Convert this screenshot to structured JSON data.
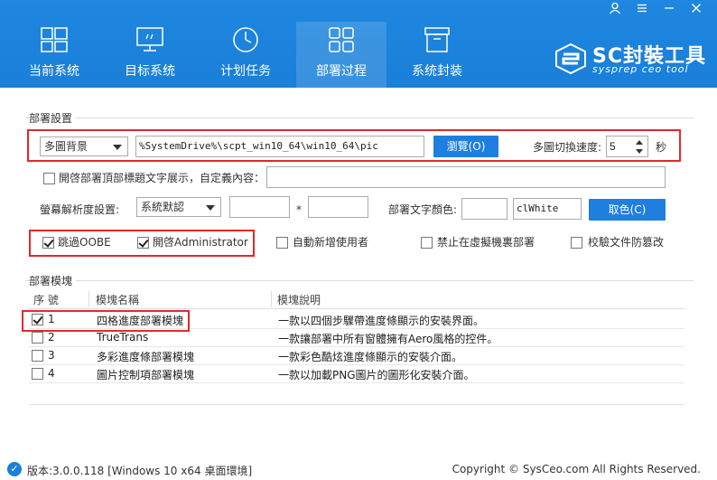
{
  "window": {
    "controls": [
      "user-icon",
      "menu-icon",
      "minimize-icon",
      "close-icon"
    ]
  },
  "tabs": [
    {
      "label": "当前系统",
      "icon": "windows-icon"
    },
    {
      "label": "目标系统",
      "icon": "monitor-icon"
    },
    {
      "label": "计划任务",
      "icon": "clock-icon"
    },
    {
      "label": "部署过程",
      "icon": "grid-icon",
      "active": true
    },
    {
      "label": "系统封装",
      "icon": "package-icon"
    }
  ],
  "logo": {
    "main": "SC封裝工具",
    "sub": "sysprep ceo tool"
  },
  "deploy": {
    "title": "部署設置",
    "bg_select": "多圖背景",
    "bg_path": "%SystemDrive%\\scpt_win10_64\\win10_64\\pic",
    "browse": "瀏覽(O)",
    "speed_label": "多圖切換速度:",
    "speed_value": "5",
    "speed_unit": "秒",
    "show_title_label": "開啓部署頂部標題文字展示，自定義內容：",
    "show_title_value": "",
    "resolution_label": "螢幕解析度設置:",
    "resolution_select": "系統默認",
    "res_w": "",
    "res_sep": "*",
    "res_h": "",
    "text_color_label": "部署文字顏色:",
    "text_color_swatch": "",
    "text_color_value": "clWhite",
    "pick_color": "取色(C)",
    "options": [
      {
        "label": "跳過OOBE",
        "checked": true
      },
      {
        "label": "開啓Administrator",
        "checked": true
      },
      {
        "label": "自動新增使用者",
        "checked": false
      },
      {
        "label": "禁止在虛擬機裏部署",
        "checked": false
      },
      {
        "label": "校驗文件防篡改",
        "checked": false
      }
    ]
  },
  "templates": {
    "title": "部署模塊",
    "columns": [
      "序 號",
      "模塊名稱",
      "模塊說明"
    ],
    "rows": [
      {
        "no": "1",
        "name": "四格進度部署模塊",
        "desc": "一款以四個步驟帶進度條顯示的安裝界面。",
        "checked": true
      },
      {
        "no": "2",
        "name": "TrueTrans",
        "desc": "一款讓部署中所有窗體擁有Aero風格的控件。",
        "checked": false
      },
      {
        "no": "3",
        "name": "多彩進度條部署模塊",
        "desc": "一款彩色酷炫進度條顯示的安裝介面。",
        "checked": false
      },
      {
        "no": "4",
        "name": "圖片控制項部署模塊",
        "desc": "一款以加載PNG圖片的圖形化安裝介面。",
        "checked": false
      }
    ]
  },
  "footer": {
    "version": "版本:3.0.0.118 [Windows 10 x64 桌面環境]",
    "copyright": "Copyright © SysCeo.com All Rights Reserved."
  },
  "colors": {
    "header": "#1a7fd8",
    "button": "#1f7fe0",
    "highlight": "#e0292a"
  }
}
